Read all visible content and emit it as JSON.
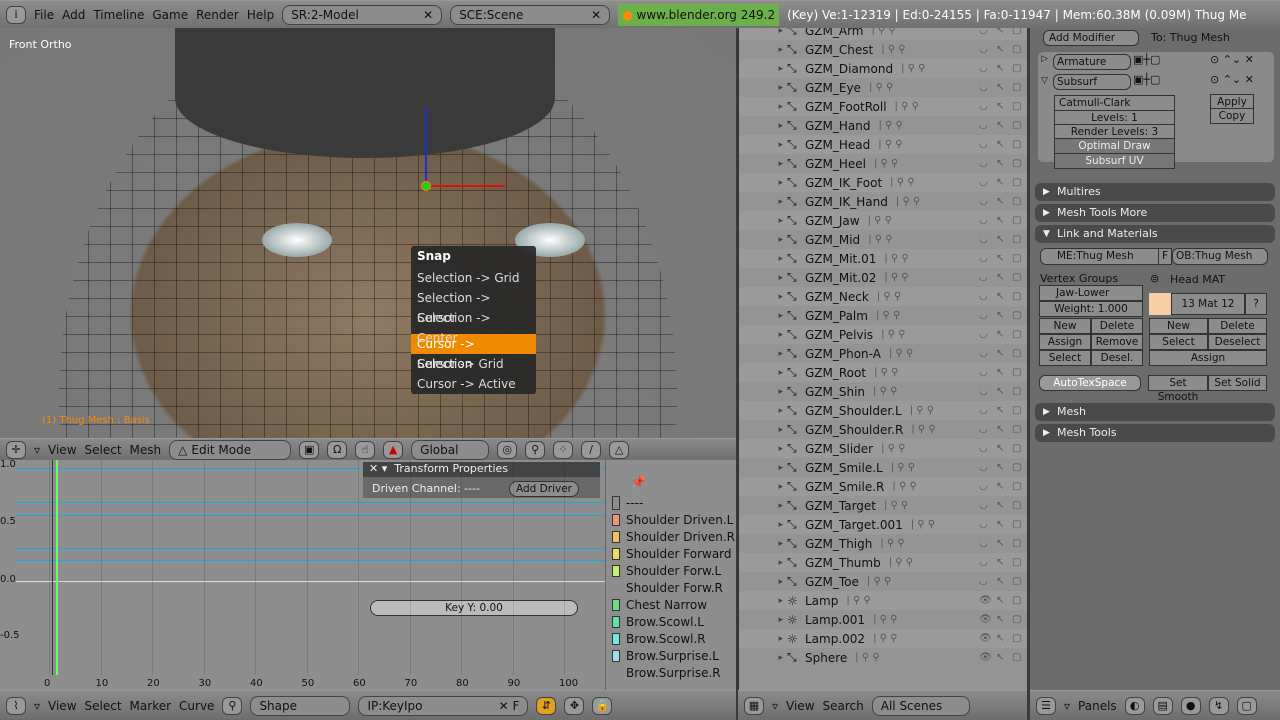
{
  "topbar": {
    "menus": [
      "File",
      "Add",
      "Timeline",
      "Game",
      "Render",
      "Help"
    ],
    "screen": "SR:2-Model",
    "scene": "SCE:Scene",
    "url": "www.blender.org 249.2",
    "stats": "(Key) Ve:1-12319 | Ed:0-24155 | Fa:0-11947 | Mem:60.38M (0.09M) Thug Me"
  },
  "viewport": {
    "view_label": "Front Ortho",
    "object_label": "(1) Thug Mesh : Basis",
    "snap_menu": {
      "title": "Snap",
      "items": [
        "Selection -> Grid",
        "Selection -> Cursor",
        "Selection -> Center",
        "Cursor -> Selection",
        "Cursor -> Grid",
        "Cursor -> Active"
      ],
      "highlighted": "Cursor -> Selection"
    },
    "header": {
      "menus": [
        "View",
        "Select",
        "Mesh"
      ],
      "mode": "Edit Mode",
      "orientation": "Global"
    }
  },
  "ipo": {
    "y_ticks": [
      "1.0",
      "0.5",
      "0.0",
      "-0.5"
    ],
    "x_ticks": [
      "0",
      "10",
      "20",
      "30",
      "40",
      "50",
      "60",
      "70",
      "80",
      "90",
      "100"
    ],
    "transform_panel": {
      "title": "Transform Properties",
      "driven_channel": "Driven Channel: ----",
      "add_driver": "Add Driver",
      "key_y": "Key Y: 0.00"
    },
    "curves": [
      {
        "name": "----",
        "color": "#8e8e8e"
      },
      {
        "name": "Shoulder Driven.L",
        "color": "#e89a7a"
      },
      {
        "name": "Shoulder Driven.R",
        "color": "#f0c060"
      },
      {
        "name": "Shoulder Forward",
        "color": "#e8e060"
      },
      {
        "name": "Shoulder Forw.L",
        "color": "#c8f070"
      },
      {
        "name": "Shoulder Forw.R",
        "color": ""
      },
      {
        "name": "Chest Narrow",
        "color": "#70d880"
      },
      {
        "name": "Brow.Scowl.L",
        "color": "#60e0a8"
      },
      {
        "name": "Brow.Scowl.R",
        "color": "#70e8e0"
      },
      {
        "name": "Brow.Surprise.L",
        "color": "#a0d8f0"
      },
      {
        "name": "Brow.Surprise.R",
        "color": ""
      }
    ],
    "header": {
      "menus": [
        "View",
        "Select",
        "Marker",
        "Curve"
      ],
      "type": "Shape",
      "ipo_name": "IP:KeyIpo",
      "f": "F"
    }
  },
  "outliner": {
    "items": [
      "GZM_Arm",
      "GZM_Chest",
      "GZM_Diamond",
      "GZM_Eye",
      "GZM_FootRoll",
      "GZM_Hand",
      "GZM_Head",
      "GZM_Heel",
      "GZM_IK_Foot",
      "GZM_IK_Hand",
      "GZM_Jaw",
      "GZM_Mid",
      "GZM_Mit.01",
      "GZM_Mit.02",
      "GZM_Neck",
      "GZM_Palm",
      "GZM_Pelvis",
      "GZM_Phon-A",
      "GZM_Root",
      "GZM_Shin",
      "GZM_Shoulder.L",
      "GZM_Shoulder.R",
      "GZM_Slider",
      "GZM_Smile.L",
      "GZM_Smile.R",
      "GZM_Target",
      "GZM_Target.001",
      "GZM_Thigh",
      "GZM_Thumb",
      "GZM_Toe",
      "Lamp",
      "Lamp.001",
      "Lamp.002",
      "Sphere"
    ],
    "header": {
      "menus": [
        "View",
        "Search"
      ],
      "filter": "All Scenes"
    }
  },
  "buttons": {
    "add_modifier": "Add Modifier",
    "to": "To: Thug Mesh",
    "modifiers": [
      "Armature",
      "Subsurf"
    ],
    "subsurf": {
      "type": "Catmull-Clark",
      "levels": "Levels: 1",
      "render_levels": "Render Levels: 3",
      "optimal": "Optimal Draw",
      "uv": "Subsurf UV",
      "apply": "Apply",
      "copy": "Copy"
    },
    "panels": [
      "Multires",
      "Mesh Tools More",
      "Link and Materials",
      "Mesh",
      "Mesh Tools"
    ],
    "link": {
      "me": "ME:Thug Mesh",
      "f": "F",
      "ob": "OB:Thug Mesh",
      "vgroups": "Vertex Groups",
      "vgroup": "Jaw-Lower",
      "weight": "Weight: 1.000",
      "mat_name": "Head MAT",
      "mat_index": "13 Mat 12",
      "q": "?",
      "vg_btns": [
        "New",
        "Delete",
        "Assign",
        "Remove",
        "Select",
        "Desel."
      ],
      "mat_btns": [
        "New",
        "Delete",
        "Select",
        "Deselect",
        "Assign"
      ],
      "autotex": "AutoTexSpace",
      "smooth": "Set Smooth",
      "solid": "Set Solid",
      "mat_color": "#f4cfa8"
    },
    "header": {
      "panels": "Panels"
    }
  }
}
